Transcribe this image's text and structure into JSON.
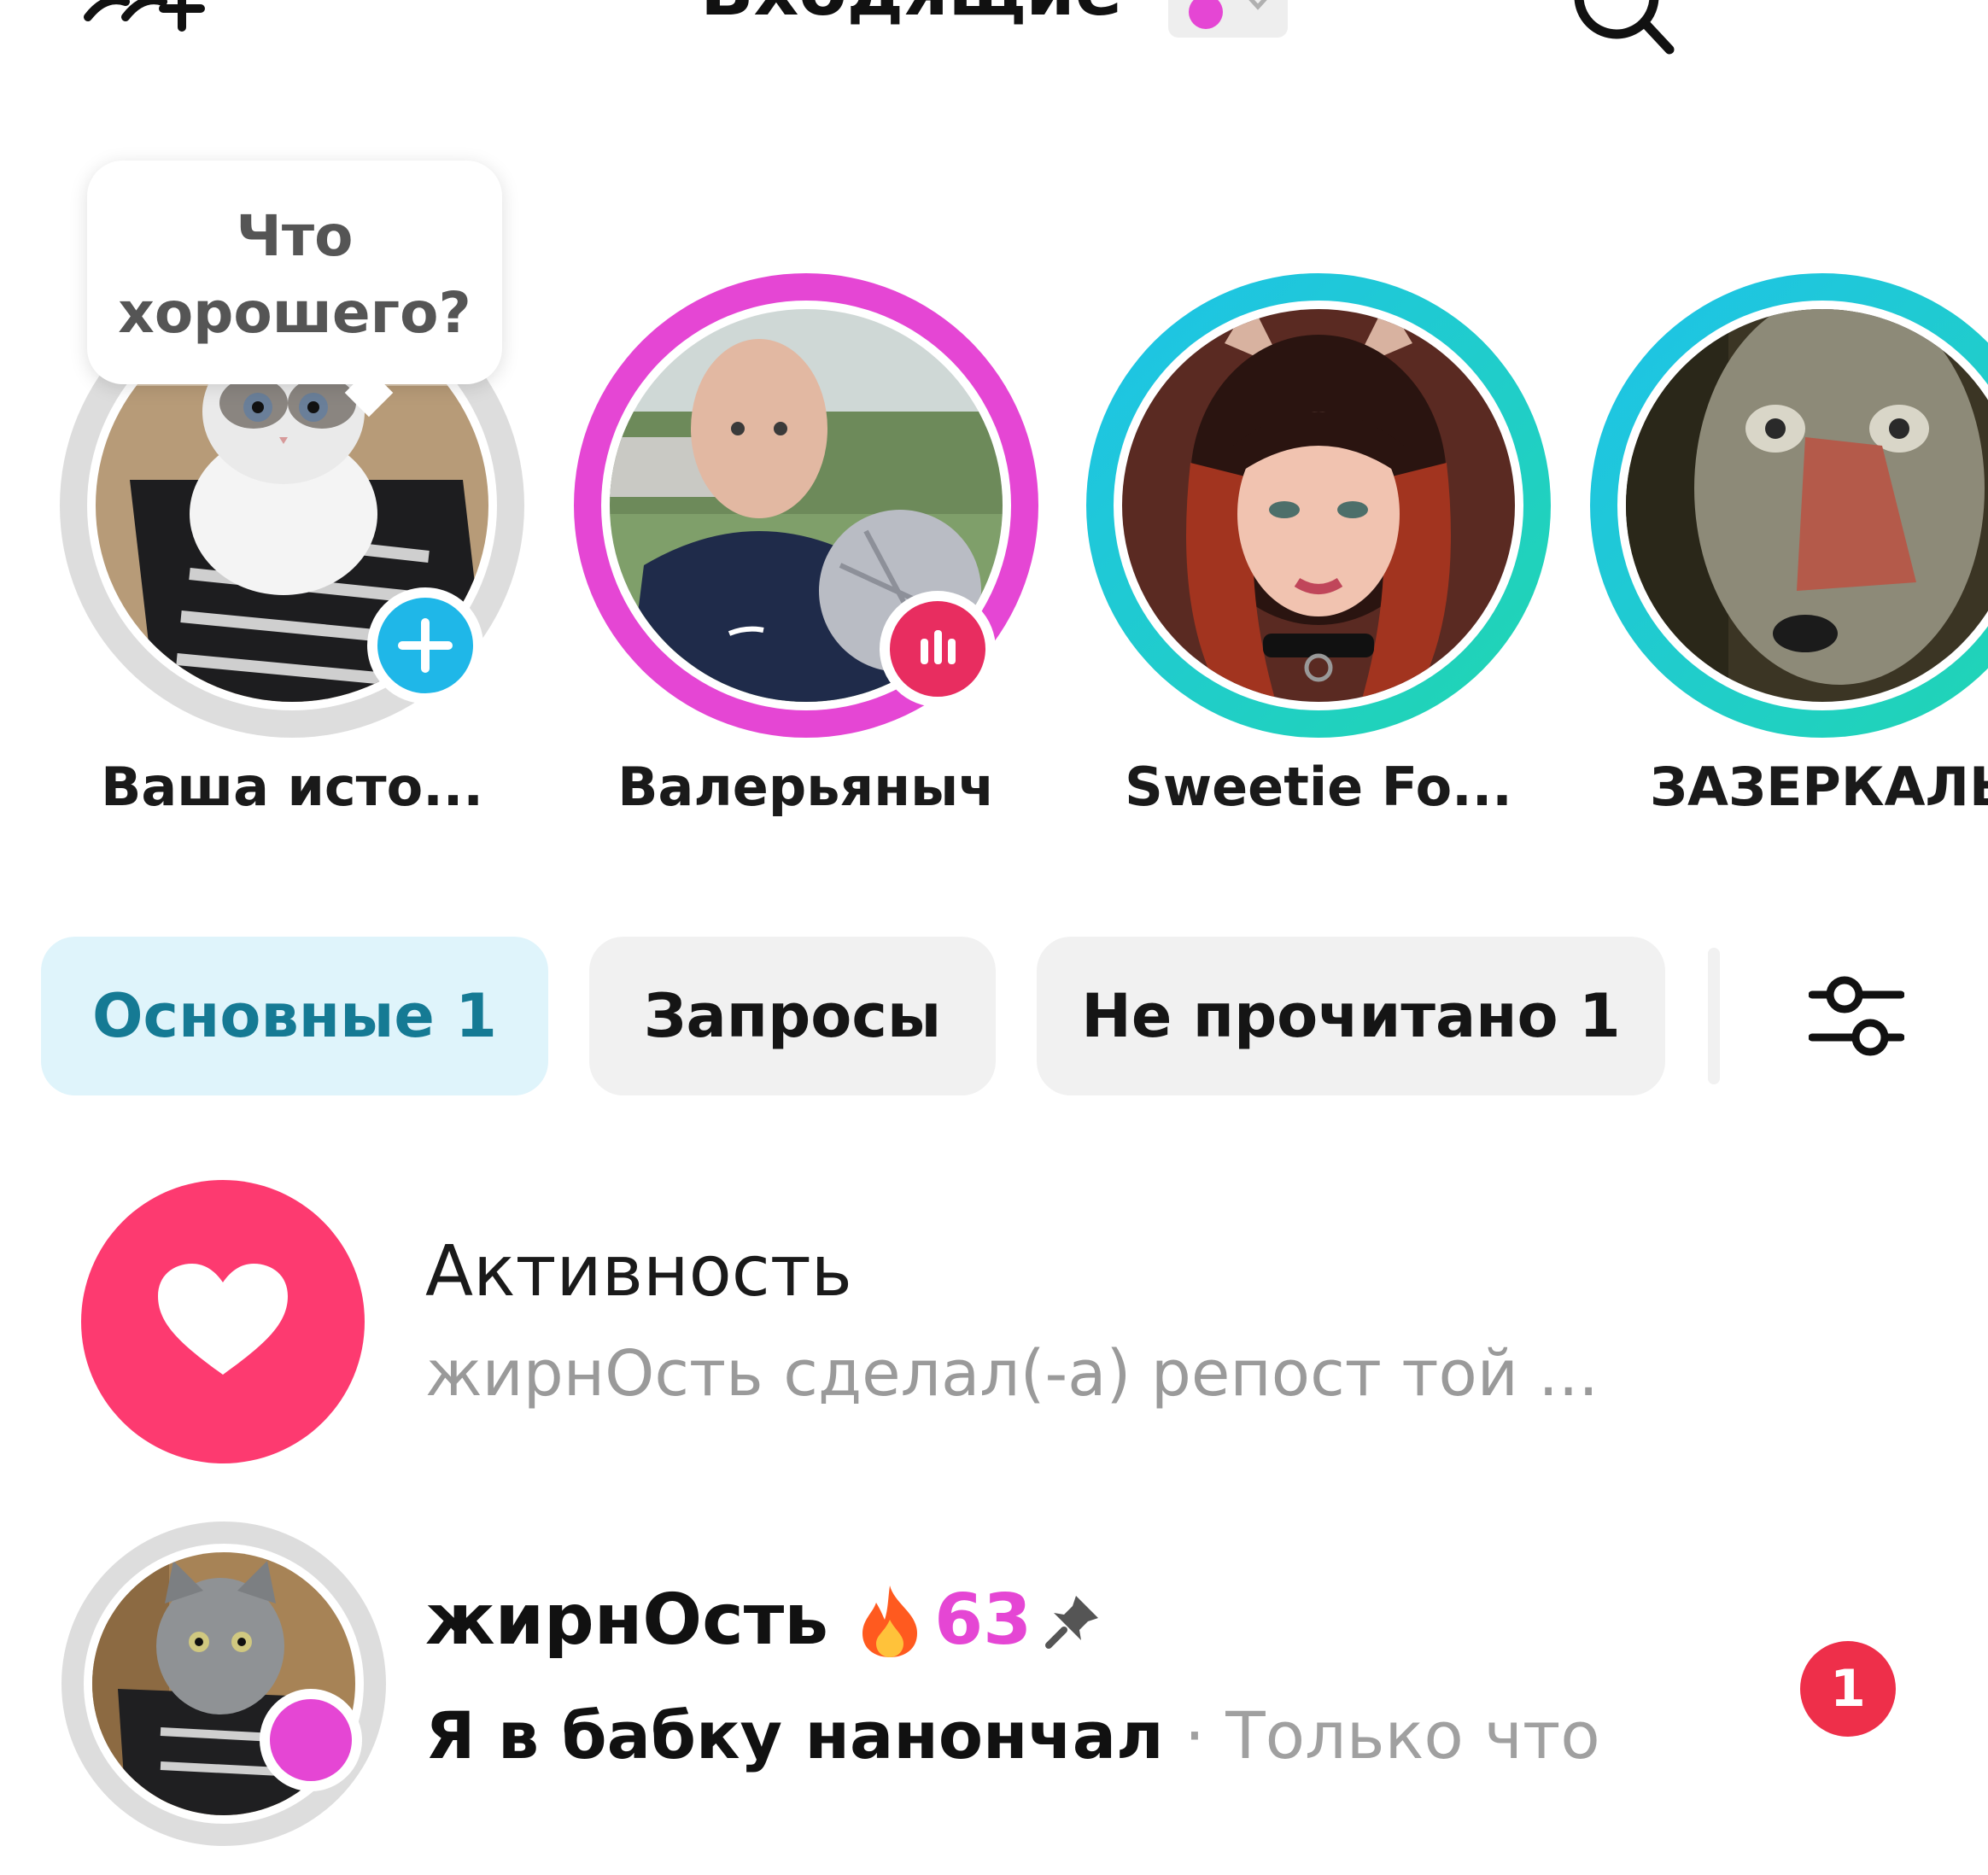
{
  "header": {
    "title": "Входящие",
    "add_friend_icon": "add-friend-icon",
    "search_icon": "search-icon",
    "more_icon": "more-icon",
    "status_color": "#e546d4"
  },
  "stories": {
    "tooltip": "Что хорошего?",
    "items": [
      {
        "name": "Ваша исто...",
        "ring_color": "#dddddd",
        "badge": "plus"
      },
      {
        "name": "Валерьяныч",
        "ring_color": "#e546d4",
        "badge": "audio"
      },
      {
        "name": "Sweetie Fo...",
        "ring_color": "#1ec2ea",
        "badge": ""
      },
      {
        "name": "ЗАЗЕРКАЛЬЕ",
        "ring_color": "#1ec2ea",
        "badge": ""
      }
    ]
  },
  "tabs": {
    "items": [
      {
        "label": "Основные 1",
        "active": true
      },
      {
        "label": "Запросы",
        "active": false
      },
      {
        "label": "Не прочитано 1",
        "active": false
      }
    ],
    "filter_icon": "sliders-icon"
  },
  "activity": {
    "title": "Активность",
    "subtitle": "жирнОсть сделал(-а) репост той ...",
    "icon": "heart-icon",
    "color": "#fd3a70"
  },
  "chat": {
    "name": "жирнОсть",
    "streak": "63",
    "message": "Я в бабку нанончал",
    "separator": "·",
    "time": "Только что",
    "unread_count": "1",
    "online_color": "#e546d4"
  }
}
